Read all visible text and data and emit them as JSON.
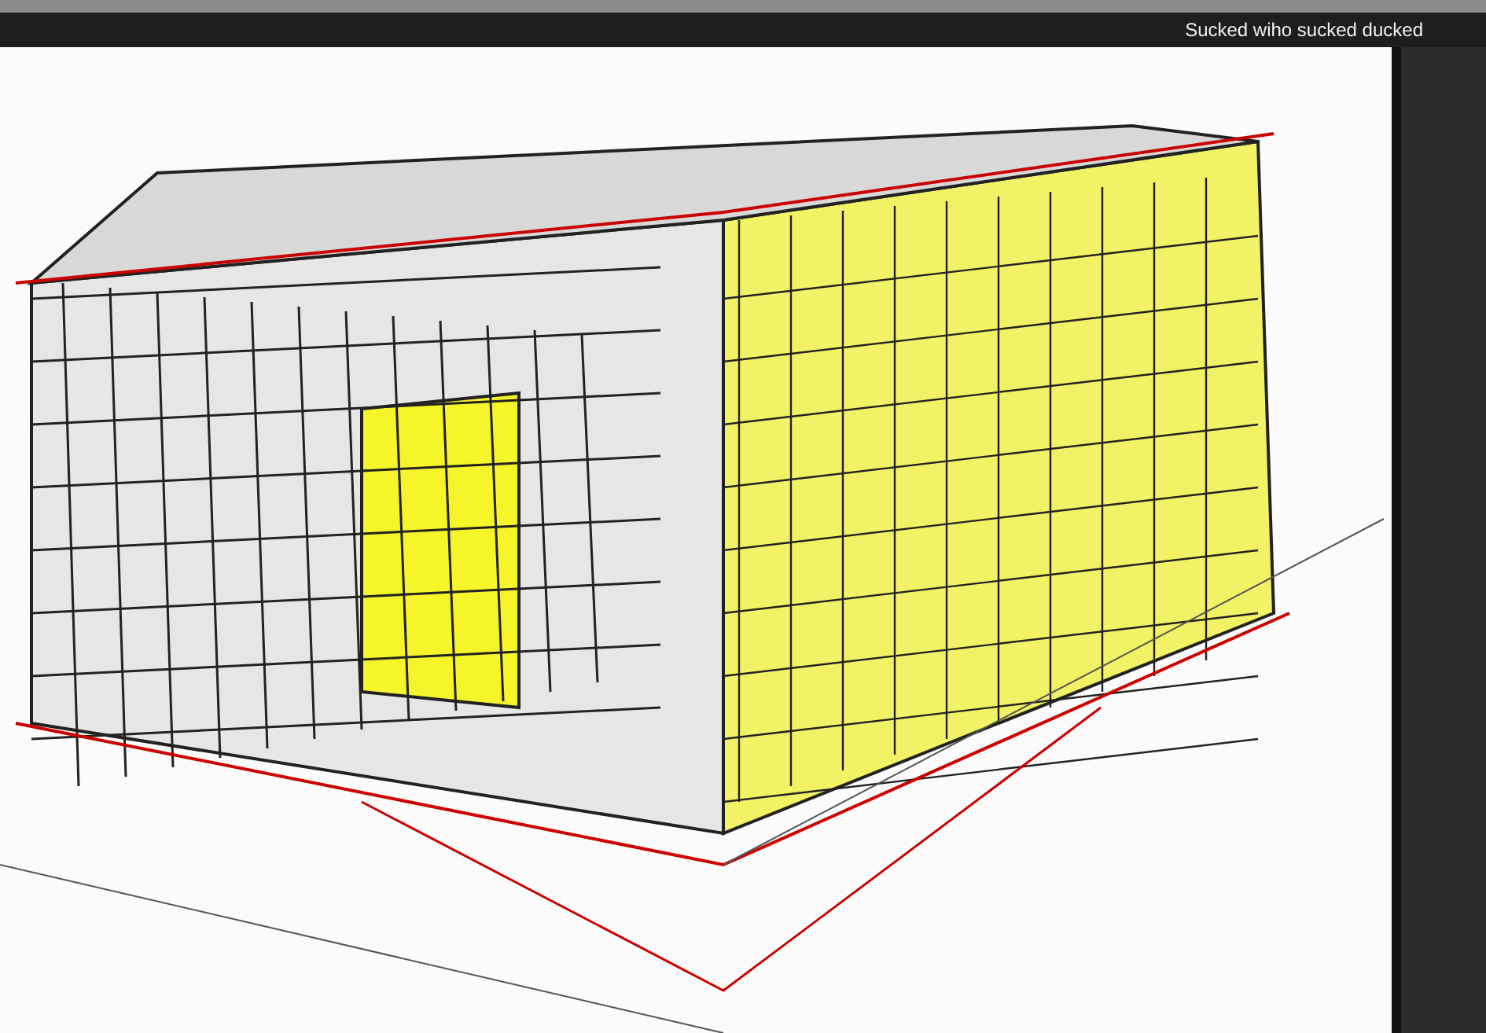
{
  "window": {
    "title": "Sucked wiho sucked ducked"
  }
}
